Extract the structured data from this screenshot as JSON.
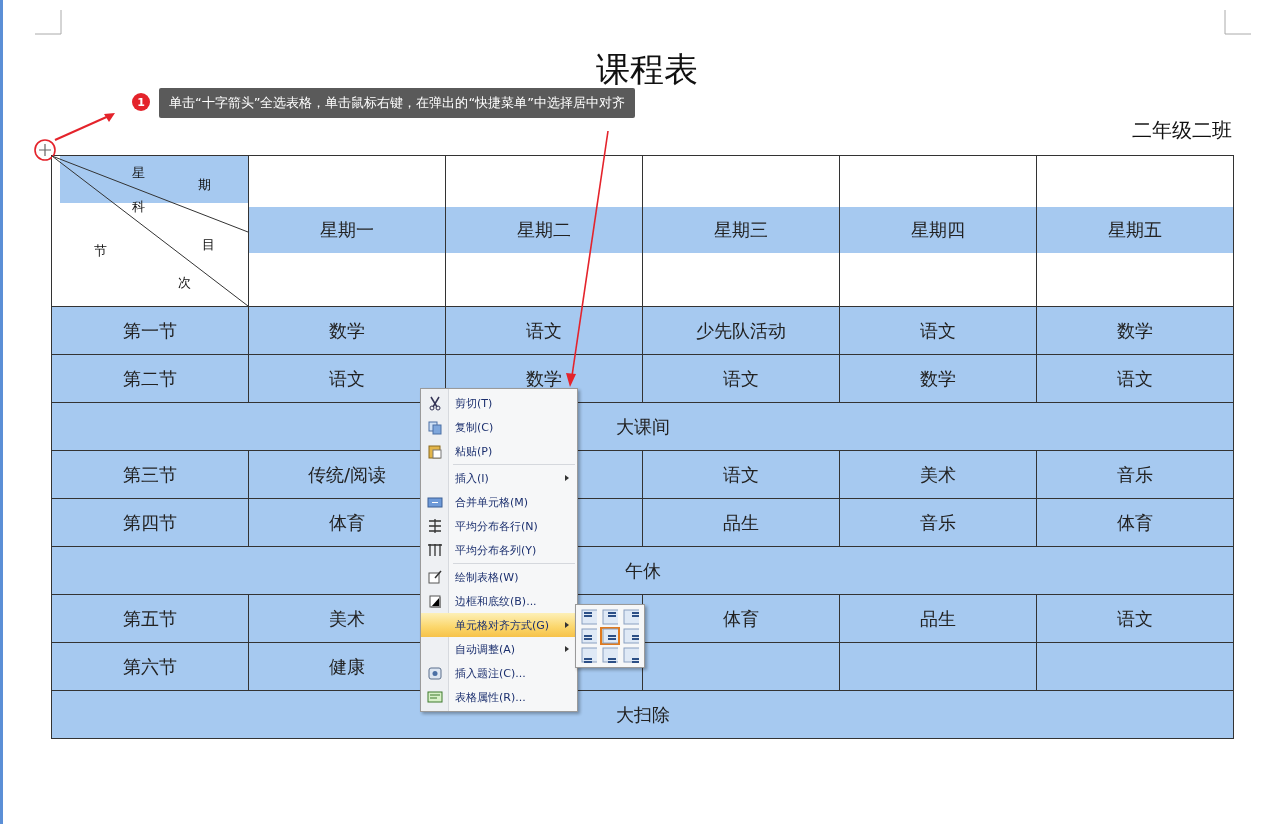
{
  "document": {
    "title": "课程表",
    "class_label": "二年级二班"
  },
  "annotation": {
    "number": "1",
    "text": "单击“十字箭头”全选表格，单击鼠标右键，在弹出的“快捷菜单”中选择居中对齐"
  },
  "table": {
    "corner_labels": [
      "星",
      "期",
      "科",
      "目",
      "节",
      "次"
    ],
    "weekdays": [
      "星期一",
      "星期二",
      "星期三",
      "星期四",
      "星期五"
    ],
    "rows": [
      {
        "kind": "lesson",
        "period": "第一节",
        "cells": [
          "数学",
          "语文",
          "少先队活动",
          "语文",
          "数学"
        ]
      },
      {
        "kind": "lesson",
        "period": "第二节",
        "cells": [
          "语文",
          "数学",
          "语文",
          "数学",
          "语文"
        ]
      },
      {
        "kind": "break",
        "label": "大课间"
      },
      {
        "kind": "lesson",
        "period": "第三节",
        "cells": [
          "传统/阅读",
          null,
          "语文",
          "美术",
          "音乐"
        ]
      },
      {
        "kind": "lesson",
        "period": "第四节",
        "cells": [
          "体育",
          null,
          "品生",
          "音乐",
          "体育"
        ]
      },
      {
        "kind": "break",
        "label": "午休"
      },
      {
        "kind": "lesson",
        "period": "第五节",
        "cells": [
          "美术",
          null,
          "体育",
          "品生",
          "语文"
        ]
      },
      {
        "kind": "lesson",
        "period": "第六节",
        "cells": [
          "健康",
          null,
          null,
          null,
          null
        ]
      },
      {
        "kind": "break",
        "label": "大扫除"
      }
    ]
  },
  "context_menu": {
    "items": [
      {
        "kind": "command",
        "label": "剪切(T)",
        "submenu": false,
        "selected": false
      },
      {
        "kind": "command",
        "label": "复制(C)",
        "submenu": false,
        "selected": false
      },
      {
        "kind": "command",
        "label": "粘贴(P)",
        "submenu": false,
        "selected": false
      },
      {
        "kind": "separator"
      },
      {
        "kind": "command",
        "label": "插入(I)",
        "submenu": true,
        "selected": false
      },
      {
        "kind": "command",
        "label": "合并单元格(M)",
        "submenu": false,
        "selected": false
      },
      {
        "kind": "command",
        "label": "平均分布各行(N)",
        "submenu": false,
        "selected": false
      },
      {
        "kind": "command",
        "label": "平均分布各列(Y)",
        "submenu": false,
        "selected": false
      },
      {
        "kind": "separator"
      },
      {
        "kind": "command",
        "label": "绘制表格(W)",
        "submenu": false,
        "selected": false
      },
      {
        "kind": "command",
        "label": "边框和底纹(B)...",
        "submenu": false,
        "selected": false
      },
      {
        "kind": "command",
        "label": "单元格对齐方式(G)",
        "submenu": true,
        "selected": true
      },
      {
        "kind": "command",
        "label": "自动调整(A)",
        "submenu": true,
        "selected": false
      },
      {
        "kind": "command",
        "label": "插入题注(C)...",
        "submenu": false,
        "selected": false
      },
      {
        "kind": "command",
        "label": "表格属性(R)...",
        "submenu": false,
        "selected": false
      }
    ],
    "align_options": [
      {
        "selected": false
      },
      {
        "selected": false
      },
      {
        "selected": false
      },
      {
        "selected": false
      },
      {
        "selected": true
      },
      {
        "selected": false
      },
      {
        "selected": false
      },
      {
        "selected": false
      },
      {
        "selected": false
      }
    ]
  }
}
